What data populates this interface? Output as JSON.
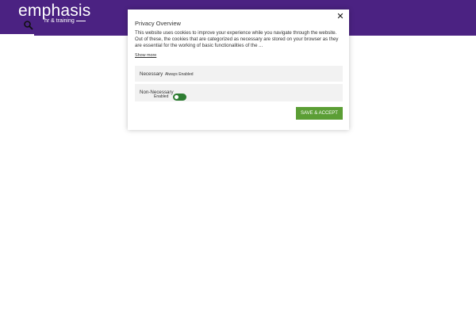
{
  "header": {
    "logo_main": "emphasis",
    "logo_sub": "hr & training",
    "search_icon": "search-icon",
    "colors": {
      "background": "#4b2282",
      "text": "#ffffff"
    }
  },
  "modal": {
    "title": "Privacy Overview",
    "close_label": "✕",
    "description": "This website uses cookies to improve your experience while you navigate through the website. Out of these, the cookies that are categorized as necessary are stored on your browser as they are essential for the working of basic functionalities of the ...",
    "show_more": "Show more",
    "categories": [
      {
        "label": "Necessary",
        "status": "Always Enabled"
      },
      {
        "label": "Non-Necessary",
        "status": "Enabled",
        "enabled": true
      }
    ],
    "accept_label": "SAVE & ACCEPT",
    "colors": {
      "accept": "#5b9e35",
      "toggle_on": "#2e7d32"
    }
  }
}
